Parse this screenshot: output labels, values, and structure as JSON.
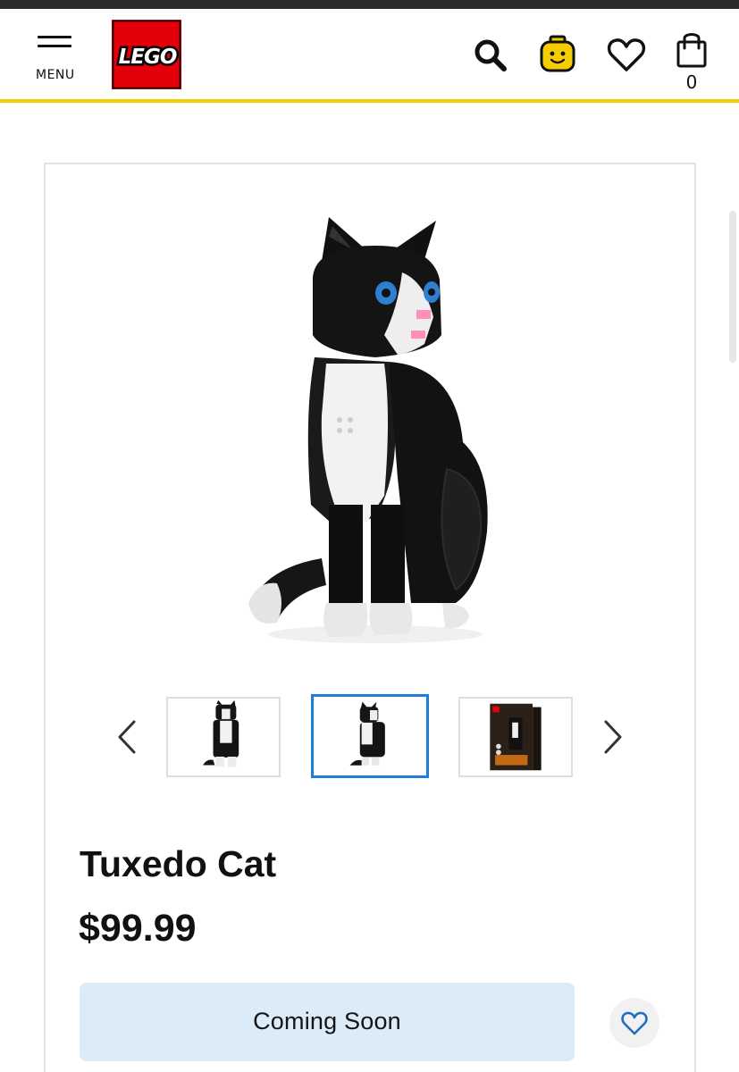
{
  "header": {
    "menu_label": "MENU",
    "brand_name": "LEGO",
    "brand_color": "#e3000b",
    "accent_color": "#f5d000",
    "bag_count": "0",
    "icons": [
      "menu-icon",
      "search-icon",
      "account-icon",
      "heart-icon",
      "shopping-bag-icon"
    ]
  },
  "product": {
    "title": "Tuxedo Cat",
    "price": "$99.99",
    "cta_label": "Coming Soon",
    "cta_color": "#dcebf8",
    "gallery": {
      "selected_index": 1,
      "selected_border_color": "#1e7fd6",
      "thumbnails": [
        "cat-front-thumbnail",
        "cat-side-thumbnail",
        "box-thumbnail"
      ],
      "prev_icon": "chevron-left-icon",
      "next_icon": "chevron-right-icon"
    },
    "wishlist_icon": "heart-icon"
  }
}
